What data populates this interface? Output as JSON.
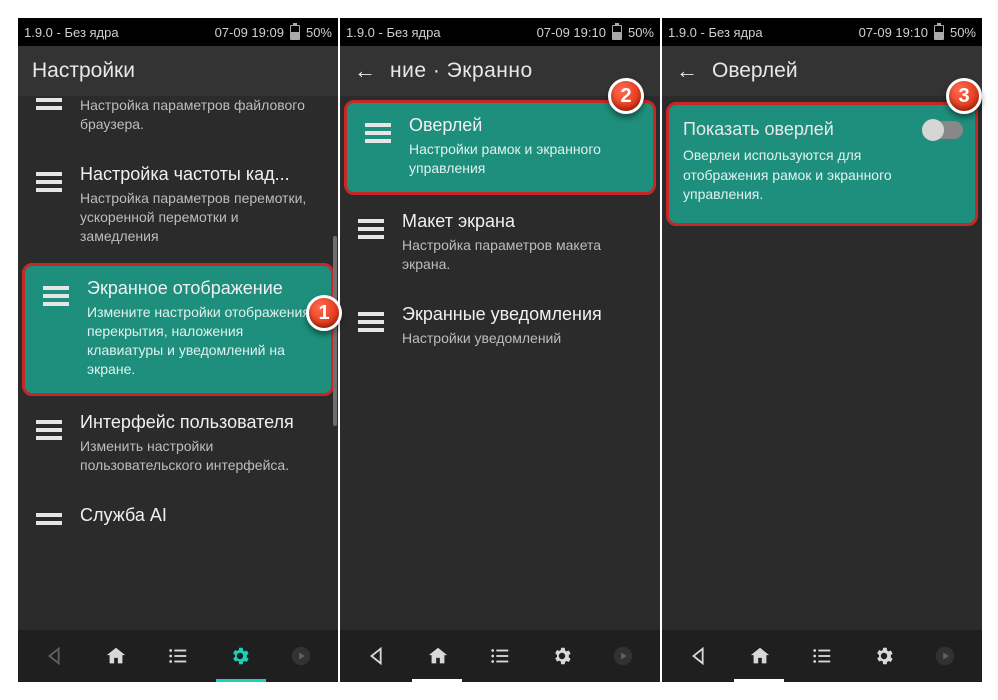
{
  "status": {
    "version_left": "1.9.0 - Без ядра",
    "time1": "07-09 19:09",
    "time2": "07-09 19:10",
    "battery": "50%"
  },
  "badges": {
    "b1": "1",
    "b2": "2",
    "b3": "3"
  },
  "panel1": {
    "title": "Настройки",
    "item0": {
      "subtitle": "Настройка параметров файлового браузера."
    },
    "item1": {
      "title": "Настройка частоты кад...",
      "subtitle": "Настройка параметров перемотки, ускоренной перемотки и замедления"
    },
    "item2": {
      "title": "Экранное отображение",
      "subtitle": "Измените настройки отображения перекрытия, наложения клавиатуры и уведомлений на экране."
    },
    "item3": {
      "title": "Интерфейс пользователя",
      "subtitle": "Изменить настройки пользовательского интерфейса."
    },
    "item4": {
      "title": "Служба AI"
    }
  },
  "panel2": {
    "title": "ние   ·   Экранно",
    "item0": {
      "title": "Оверлей",
      "subtitle": "Настройки рамок и экранного управления"
    },
    "item1": {
      "title": "Макет экрана",
      "subtitle": "Настройка параметров макета экрана."
    },
    "item2": {
      "title": "Экранные уведомления",
      "subtitle": "Настройки уведомлений"
    }
  },
  "panel3": {
    "title": "Оверлей",
    "toggle": {
      "title": "Показать оверлей",
      "subtitle": "Оверлеи используются для отображения рамок и экранного управления."
    }
  }
}
